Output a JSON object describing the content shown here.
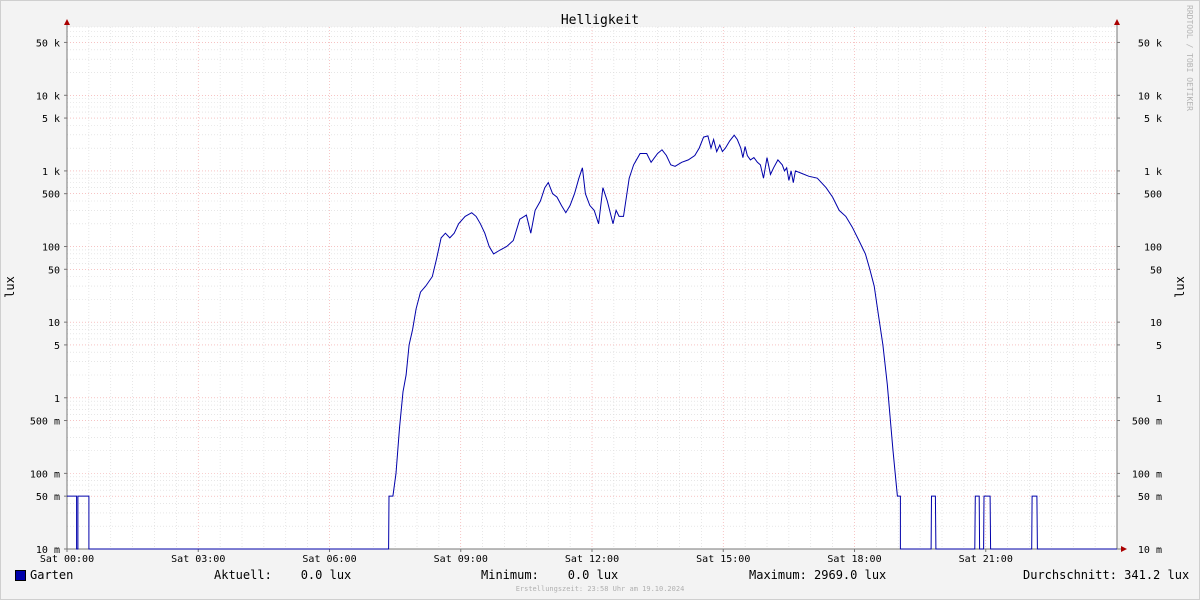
{
  "chart_data": {
    "type": "line",
    "title": "Helligkeit",
    "ylabel": "lux",
    "yscale": "log",
    "ylim": [
      0.01,
      80000
    ],
    "y_ticks": [
      {
        "value": 50000,
        "label": "50 k"
      },
      {
        "value": 10000,
        "label": "10 k"
      },
      {
        "value": 5000,
        "label": "5 k"
      },
      {
        "value": 1000,
        "label": "1 k"
      },
      {
        "value": 500,
        "label": "500"
      },
      {
        "value": 100,
        "label": "100"
      },
      {
        "value": 50,
        "label": "50"
      },
      {
        "value": 10,
        "label": "10"
      },
      {
        "value": 5,
        "label": "5"
      },
      {
        "value": 1,
        "label": "1"
      },
      {
        "value": 0.5,
        "label": "500 m"
      },
      {
        "value": 0.1,
        "label": "100 m"
      },
      {
        "value": 0.05,
        "label": "50 m"
      },
      {
        "value": 0.01,
        "label": "10 m"
      }
    ],
    "x_ticks": [
      {
        "hour": 0,
        "label": "Sat 00:00"
      },
      {
        "hour": 3,
        "label": "Sat 03:00"
      },
      {
        "hour": 6,
        "label": "Sat 06:00"
      },
      {
        "hour": 9,
        "label": "Sat 09:00"
      },
      {
        "hour": 12,
        "label": "Sat 12:00"
      },
      {
        "hour": 15,
        "label": "Sat 15:00"
      },
      {
        "hour": 18,
        "label": "Sat 18:00"
      },
      {
        "hour": 21,
        "label": "Sat 21:00"
      }
    ],
    "xlim_hours": [
      0,
      24
    ],
    "grid": true,
    "series": [
      {
        "name": "Garten",
        "color": "#0000aa",
        "points": [
          [
            0.0,
            0.05
          ],
          [
            0.22,
            0.05
          ],
          [
            0.22,
            0.01
          ],
          [
            0.25,
            0.01
          ],
          [
            0.25,
            0.05
          ],
          [
            0.5,
            0.05
          ],
          [
            0.5,
            0.01
          ],
          [
            7.35,
            0.01
          ],
          [
            7.36,
            0.05
          ],
          [
            7.45,
            0.05
          ],
          [
            7.52,
            0.1
          ],
          [
            7.6,
            0.4
          ],
          [
            7.68,
            1.2
          ],
          [
            7.75,
            2
          ],
          [
            7.82,
            5
          ],
          [
            7.9,
            8
          ],
          [
            7.98,
            15
          ],
          [
            8.08,
            25
          ],
          [
            8.2,
            30
          ],
          [
            8.35,
            40
          ],
          [
            8.45,
            70
          ],
          [
            8.55,
            130
          ],
          [
            8.65,
            150
          ],
          [
            8.75,
            130
          ],
          [
            8.85,
            150
          ],
          [
            8.95,
            200
          ],
          [
            9.1,
            250
          ],
          [
            9.25,
            280
          ],
          [
            9.35,
            250
          ],
          [
            9.45,
            200
          ],
          [
            9.55,
            150
          ],
          [
            9.65,
            100
          ],
          [
            9.75,
            80
          ],
          [
            9.9,
            90
          ],
          [
            10.05,
            100
          ],
          [
            10.2,
            120
          ],
          [
            10.35,
            230
          ],
          [
            10.5,
            260
          ],
          [
            10.6,
            150
          ],
          [
            10.7,
            300
          ],
          [
            10.82,
            400
          ],
          [
            10.92,
            600
          ],
          [
            11.0,
            700
          ],
          [
            11.1,
            500
          ],
          [
            11.2,
            450
          ],
          [
            11.3,
            350
          ],
          [
            11.4,
            280
          ],
          [
            11.5,
            350
          ],
          [
            11.6,
            500
          ],
          [
            11.7,
            800
          ],
          [
            11.78,
            1100
          ],
          [
            11.85,
            500
          ],
          [
            11.95,
            350
          ],
          [
            12.05,
            300
          ],
          [
            12.15,
            200
          ],
          [
            12.25,
            600
          ],
          [
            12.35,
            400
          ],
          [
            12.48,
            200
          ],
          [
            12.55,
            300
          ],
          [
            12.62,
            250
          ],
          [
            12.72,
            250
          ],
          [
            12.85,
            800
          ],
          [
            12.95,
            1200
          ],
          [
            13.1,
            1700
          ],
          [
            13.25,
            1700
          ],
          [
            13.35,
            1300
          ],
          [
            13.5,
            1700
          ],
          [
            13.6,
            1900
          ],
          [
            13.7,
            1600
          ],
          [
            13.8,
            1200
          ],
          [
            13.9,
            1150
          ],
          [
            14.05,
            1300
          ],
          [
            14.2,
            1400
          ],
          [
            14.35,
            1600
          ],
          [
            14.45,
            2000
          ],
          [
            14.55,
            2800
          ],
          [
            14.65,
            2900
          ],
          [
            14.72,
            2000
          ],
          [
            14.78,
            2600
          ],
          [
            14.85,
            1800
          ],
          [
            14.92,
            2200
          ],
          [
            14.98,
            1800
          ],
          [
            15.05,
            2000
          ],
          [
            15.15,
            2500
          ],
          [
            15.25,
            2969
          ],
          [
            15.32,
            2600
          ],
          [
            15.4,
            2000
          ],
          [
            15.45,
            1500
          ],
          [
            15.5,
            2100
          ],
          [
            15.55,
            1600
          ],
          [
            15.62,
            1400
          ],
          [
            15.7,
            1500
          ],
          [
            15.78,
            1300
          ],
          [
            15.85,
            1200
          ],
          [
            15.92,
            800
          ],
          [
            16.0,
            1500
          ],
          [
            16.08,
            900
          ],
          [
            16.15,
            1100
          ],
          [
            16.25,
            1400
          ],
          [
            16.35,
            1200
          ],
          [
            16.4,
            1000
          ],
          [
            16.45,
            1100
          ],
          [
            16.5,
            750
          ],
          [
            16.55,
            1000
          ],
          [
            16.6,
            700
          ],
          [
            16.65,
            1000
          ],
          [
            16.75,
            950
          ],
          [
            16.95,
            850
          ],
          [
            17.15,
            800
          ],
          [
            17.35,
            600
          ],
          [
            17.5,
            450
          ],
          [
            17.65,
            300
          ],
          [
            17.8,
            250
          ],
          [
            17.95,
            180
          ],
          [
            18.1,
            120
          ],
          [
            18.25,
            80
          ],
          [
            18.35,
            50
          ],
          [
            18.45,
            30
          ],
          [
            18.55,
            12
          ],
          [
            18.65,
            5
          ],
          [
            18.75,
            1.5
          ],
          [
            18.82,
            0.5
          ],
          [
            18.88,
            0.2
          ],
          [
            18.93,
            0.1
          ],
          [
            18.98,
            0.05
          ],
          [
            19.05,
            0.05
          ],
          [
            19.05,
            0.01
          ],
          [
            19.75,
            0.01
          ],
          [
            19.76,
            0.05
          ],
          [
            19.85,
            0.05
          ],
          [
            19.86,
            0.01
          ],
          [
            20.75,
            0.01
          ],
          [
            20.76,
            0.05
          ],
          [
            20.85,
            0.05
          ],
          [
            20.86,
            0.01
          ],
          [
            20.95,
            0.01
          ],
          [
            20.96,
            0.05
          ],
          [
            21.1,
            0.05
          ],
          [
            21.11,
            0.01
          ],
          [
            22.05,
            0.01
          ],
          [
            22.06,
            0.05
          ],
          [
            22.17,
            0.05
          ],
          [
            22.18,
            0.01
          ],
          [
            24.0,
            0.01
          ]
        ]
      }
    ]
  },
  "legend": {
    "series_name": "Garten",
    "current": "Aktuell:    0.0 lux",
    "minimum": "Minimum:    0.0 lux",
    "maximum": "Maximum: 2969.0 lux",
    "average": "Durchschnitt: 341.2 lux"
  },
  "watermark": "RRDTOOL / TOBI OETIKER",
  "created": "Erstellungszeit: 23:58 Uhr am 19.10.2024"
}
